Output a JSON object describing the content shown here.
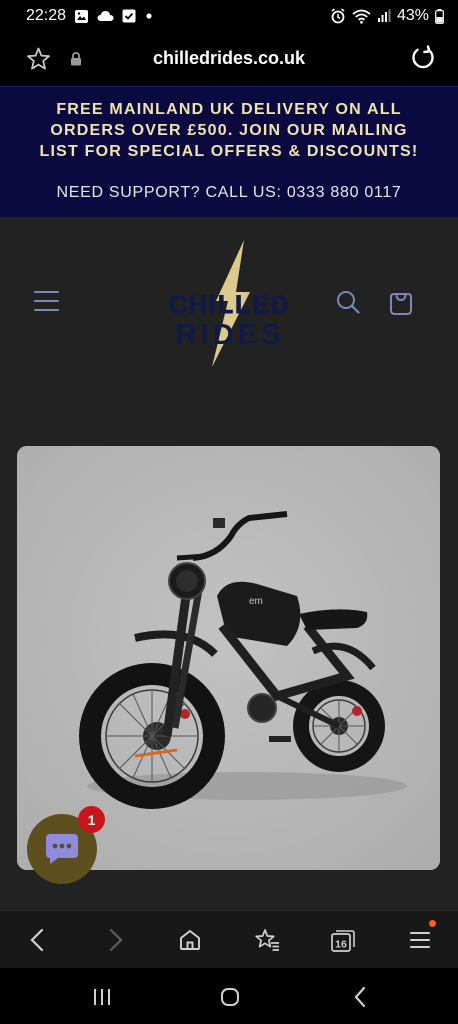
{
  "status_bar": {
    "time": "22:28",
    "battery": "43%",
    "left_icons": [
      "gallery-icon",
      "cloud-icon",
      "checkbox-icon",
      "dot-icon"
    ],
    "right_icons": [
      "alarm-icon",
      "wifi-icon",
      "signal-icon",
      "battery-icon"
    ]
  },
  "browser": {
    "url": "chilledrides.co.uk",
    "bookmark_icon": "star-outline-icon",
    "security_icon": "lock-icon",
    "reload_icon": "reload-icon"
  },
  "announcement": {
    "offer_text": "FREE MAINLAND UK DELIVERY ON ALL ORDERS OVER £500. JOIN OUR MAILING LIST FOR SPECIAL OFFERS & DISCOUNTS!",
    "support_text": "NEED SUPPORT? CALL US: 0333 880 0117",
    "colors": {
      "background": "#0a0a40",
      "offer": "#efe3ae",
      "support": "#e6e6ec"
    }
  },
  "header": {
    "logo": {
      "line1": "CHILLED",
      "line2": "RIDES",
      "bolt_color": "#dcc98e",
      "text_color": "#101a44"
    },
    "menu_icon": "hamburger-menu-icon",
    "search_icon": "search-icon",
    "cart_icon": "cart-icon",
    "icon_color": "#7d86b8"
  },
  "product": {
    "image_subject": "black electric fat-tire motorbike-style e-bike",
    "frame_badge": "em"
  },
  "chat": {
    "badge_count": "1",
    "icon": "chat-bubble-icon",
    "color": "#5e4f1e"
  },
  "browser_nav": {
    "items": [
      "back-icon",
      "forward-icon",
      "home-icon",
      "bookmarks-icon",
      "tabs-icon",
      "menu-icon"
    ],
    "tab_count": "16"
  },
  "system_nav": {
    "items": [
      "recents-icon",
      "home-button-icon",
      "back-nav-icon"
    ]
  }
}
